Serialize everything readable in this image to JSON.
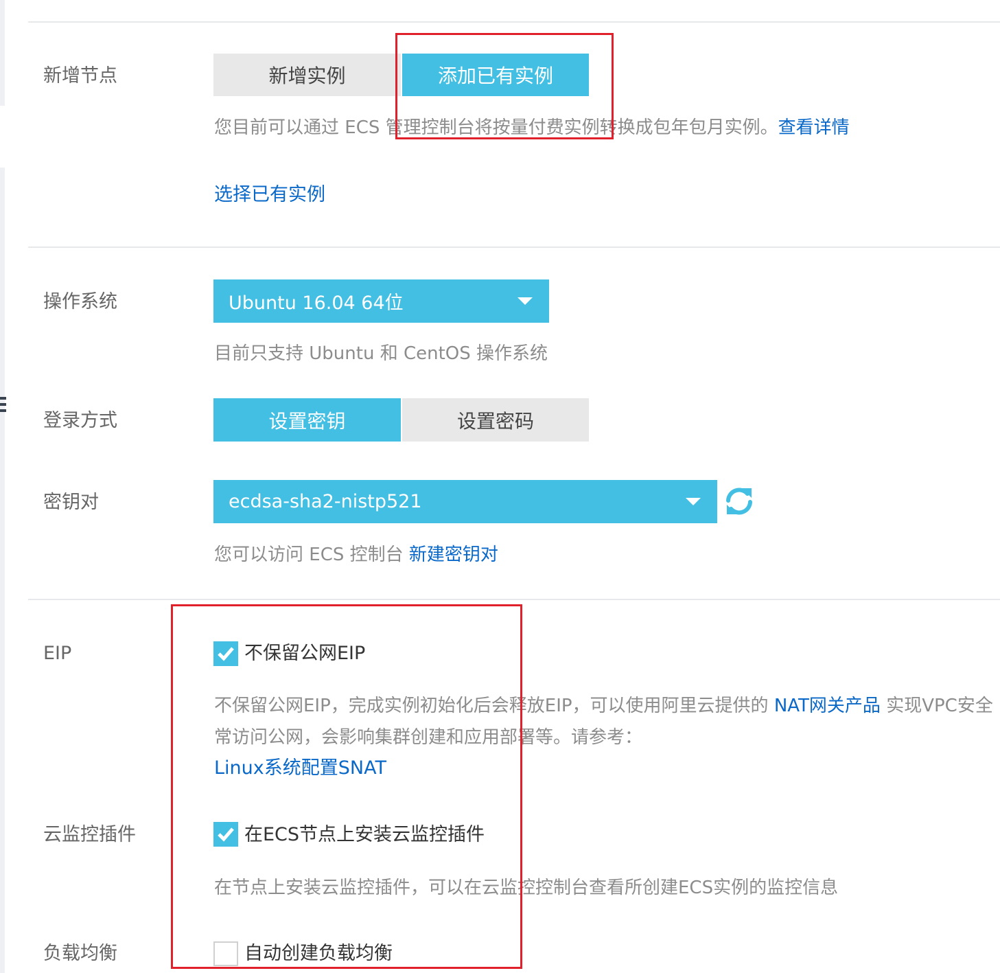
{
  "sections": {
    "add_node": {
      "label": "新增节点",
      "tabs": [
        "新增实例",
        "添加已有实例"
      ],
      "active_tab": "添加已有实例",
      "hint_text": "您目前可以通过 ECS 管理控制台将按量付费实例转换成包年包月实例。",
      "hint_link": "查看详情",
      "select_existing_link": "选择已有实例"
    },
    "os": {
      "label": "操作系统",
      "selected": "Ubuntu 16.04 64位",
      "hint": "目前只支持 Ubuntu 和 CentOS 操作系统"
    },
    "login": {
      "label": "登录方式",
      "tabs": [
        "设置密钥",
        "设置密码"
      ],
      "active_tab": "设置密钥"
    },
    "keypair": {
      "label": "密钥对",
      "selected": "ecdsa-sha2-nistp521",
      "hint_text": "您可以访问 ECS 控制台",
      "hint_link": "新建密钥对"
    },
    "eip": {
      "label": "EIP",
      "checkbox_label": "不保留公网EIP",
      "checked": true,
      "desc_line1_a": "不保留公网EIP，完成实例初始化后会释放EIP，可以使用阿里云提供的",
      "desc_line1_link": "NAT网关产品",
      "desc_line1_b": "实现VPC安全",
      "desc_line2": "常访问公网，会影响集群创建和应用部署等。请参考：",
      "desc_link": "Linux系统配置SNAT"
    },
    "monitor": {
      "label": "云监控插件",
      "checkbox_label": "在ECS节点上安装云监控插件",
      "checked": true,
      "desc": "在节点上安装云监控插件，可以在云监控控制台查看所创建ECS实例的监控信息"
    },
    "slb": {
      "label": "负载均衡",
      "checkbox_label": "自动创建负载均衡",
      "checked": false
    }
  },
  "colors": {
    "accent": "#42bfe2",
    "link": "#0a68c8",
    "highlight_box": "#e0202a"
  },
  "icons": {
    "refresh": "refresh-icon",
    "dropdown": "caret-down-icon",
    "check": "check-icon"
  }
}
